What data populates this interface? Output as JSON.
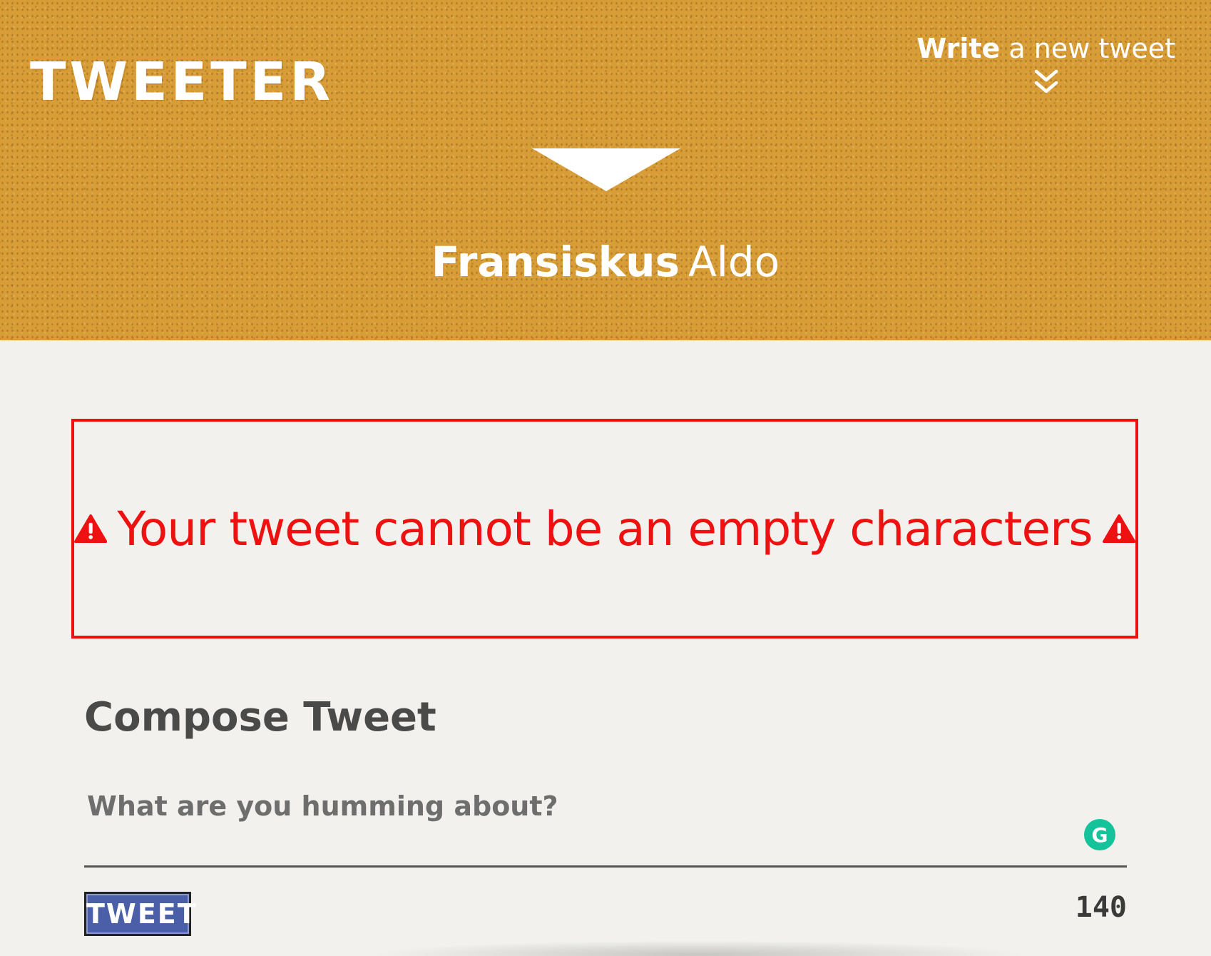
{
  "header": {
    "logo": "TWEETER",
    "write_link": {
      "bold": "Write",
      "rest": "a new tweet"
    },
    "chevron_icon": "double-chevron-down-icon",
    "triangle_icon": "triangle-down-icon",
    "user": {
      "first_name": "Fransiskus",
      "last_name": "Aldo"
    },
    "background_color": "#d89d37"
  },
  "error": {
    "message": "Your tweet cannot be an empty characters",
    "icon": "warning-icon",
    "color": "#ee1111"
  },
  "compose": {
    "title": "Compose Tweet",
    "placeholder": "What are you humming about?",
    "value": "",
    "grammarly_label": "G",
    "tweet_button": "TWEET",
    "char_count": "140",
    "button_color": "#4a5fa8"
  }
}
